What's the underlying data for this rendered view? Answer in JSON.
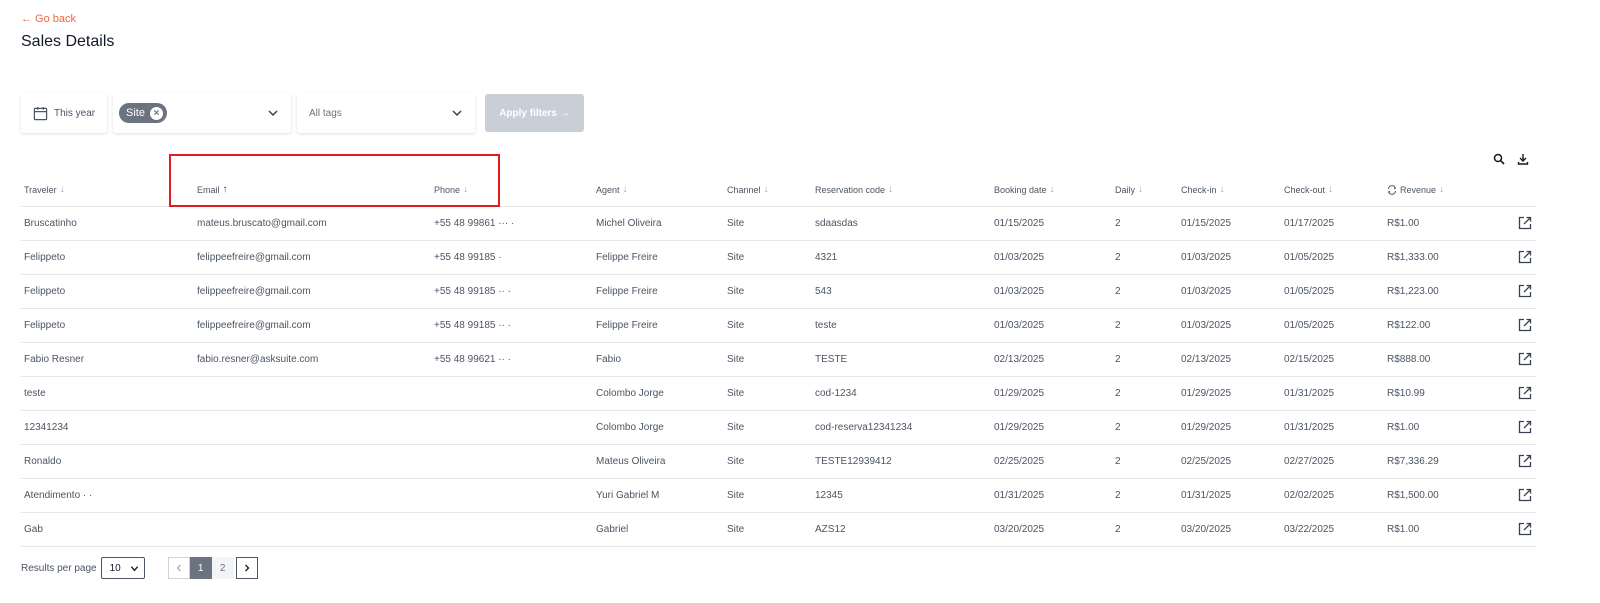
{
  "back_link": "← Go back",
  "page_title": "Sales Details",
  "filters": {
    "date_label": "This year",
    "channel_chip": "Site",
    "tags_placeholder": "All tags",
    "apply_label": "Apply filters →"
  },
  "table": {
    "columns": [
      "Traveler",
      "Email",
      "Phone",
      "Agent",
      "Channel",
      "Reservation code",
      "Booking date",
      "Daily",
      "Check-in",
      "Check-out",
      "Revenue"
    ],
    "sorted_column": "Email",
    "sort_direction": "ascending",
    "rows": [
      {
        "traveler": "Bruscatinho",
        "email": "mateus.bruscato@gmail.com",
        "phone": "+55 48 99861 ··· ·",
        "agent": "Michel Oliveira",
        "channel": "Site",
        "reservation_code": "sdaasdas",
        "booking_date": "01/15/2025",
        "daily": "2",
        "check_in": "01/15/2025",
        "check_out": "01/17/2025",
        "revenue": "R$1.00"
      },
      {
        "traveler": "Felippeto",
        "email": "felippeefreire@gmail.com",
        "phone": "+55 48 99185 ·",
        "agent": "Felippe Freire",
        "channel": "Site",
        "reservation_code": "4321",
        "booking_date": "01/03/2025",
        "daily": "2",
        "check_in": "01/03/2025",
        "check_out": "01/05/2025",
        "revenue": "R$1,333.00"
      },
      {
        "traveler": "Felippeto",
        "email": "felippeefreire@gmail.com",
        "phone": "+55 48 99185 ·· ·",
        "agent": "Felippe Freire",
        "channel": "Site",
        "reservation_code": "543",
        "booking_date": "01/03/2025",
        "daily": "2",
        "check_in": "01/03/2025",
        "check_out": "01/05/2025",
        "revenue": "R$1,223.00"
      },
      {
        "traveler": "Felippeto",
        "email": "felippeefreire@gmail.com",
        "phone": "+55 48 99185 ·· ·",
        "agent": "Felippe Freire",
        "channel": "Site",
        "reservation_code": "teste",
        "booking_date": "01/03/2025",
        "daily": "2",
        "check_in": "01/03/2025",
        "check_out": "01/05/2025",
        "revenue": "R$122.00"
      },
      {
        "traveler": "Fabio Resner",
        "email": "fabio.resner@asksuite.com",
        "phone": "+55 48 99621 ·· ·",
        "agent": "Fabio",
        "channel": "Site",
        "reservation_code": "TESTE",
        "booking_date": "02/13/2025",
        "daily": "2",
        "check_in": "02/13/2025",
        "check_out": "02/15/2025",
        "revenue": "R$888.00"
      },
      {
        "traveler": "teste",
        "email": "",
        "phone": "",
        "agent": "Colombo Jorge",
        "channel": "Site",
        "reservation_code": "cod-1234",
        "booking_date": "01/29/2025",
        "daily": "2",
        "check_in": "01/29/2025",
        "check_out": "01/31/2025",
        "revenue": "R$10.99"
      },
      {
        "traveler": "12341234",
        "email": "",
        "phone": "",
        "agent": "Colombo Jorge",
        "channel": "Site",
        "reservation_code": "cod-reserva12341234",
        "booking_date": "01/29/2025",
        "daily": "2",
        "check_in": "01/29/2025",
        "check_out": "01/31/2025",
        "revenue": "R$1.00"
      },
      {
        "traveler": "Ronaldo",
        "email": "",
        "phone": "",
        "agent": "Mateus Oliveira",
        "channel": "Site",
        "reservation_code": "TESTE12939412",
        "booking_date": "02/25/2025",
        "daily": "2",
        "check_in": "02/25/2025",
        "check_out": "02/27/2025",
        "revenue": "R$7,336.29"
      },
      {
        "traveler": "Atendimento · ·",
        "email": "",
        "phone": "",
        "agent": "Yuri Gabriel M",
        "channel": "Site",
        "reservation_code": "12345",
        "booking_date": "01/31/2025",
        "daily": "2",
        "check_in": "01/31/2025",
        "check_out": "02/02/2025",
        "revenue": "R$1,500.00"
      },
      {
        "traveler": "Gab",
        "email": "",
        "phone": "",
        "agent": "Gabriel",
        "channel": "Site",
        "reservation_code": "AZS12",
        "booking_date": "03/20/2025",
        "daily": "2",
        "check_in": "03/20/2025",
        "check_out": "03/22/2025",
        "revenue": "R$1.00"
      }
    ]
  },
  "pagination": {
    "results_per_page_label": "Results per page",
    "per_page_value": "10",
    "pages": [
      "1",
      "2"
    ],
    "current_page": "1"
  },
  "colors": {
    "accent": "#f2683a",
    "highlight_box": "#e11d1d",
    "apply_disabled": "#c9cfd7",
    "chip": "#6b7280"
  },
  "icons": [
    "arrow-left-icon",
    "calendar-icon",
    "chevron-down-icon",
    "close-icon",
    "search-icon",
    "download-icon",
    "sort-arrow-icon",
    "currency-exchange-icon",
    "external-link-icon",
    "chevron-left-icon",
    "chevron-right-icon"
  ]
}
